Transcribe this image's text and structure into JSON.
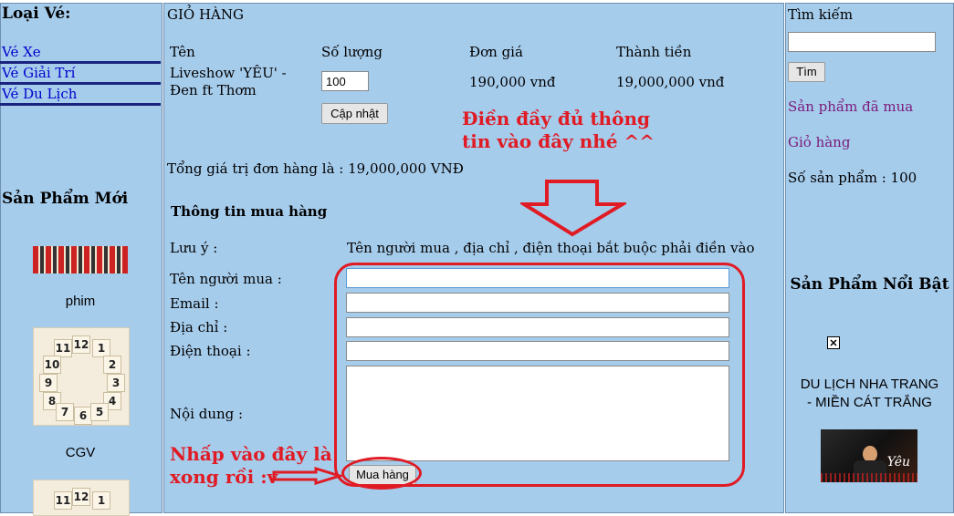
{
  "left": {
    "heading": "Loại Vé:",
    "categories": [
      "Vé Xe",
      "Vé Giải Trí",
      "Vé Du Lịch"
    ],
    "new_products_title": "Sản Phẩm Mới",
    "products": [
      {
        "caption": "phim"
      },
      {
        "caption": "CGV"
      }
    ]
  },
  "cart": {
    "title": "GIỎ HÀNG",
    "headers": {
      "name": "Tên",
      "qty": "Số lượng",
      "price": "Đơn giá",
      "total": "Thành tiền"
    },
    "item": {
      "name": "Liveshow 'YÊU' - Đen ft Thơm",
      "qty": "100",
      "price": "190,000 vnđ",
      "total": "19,000,000 vnđ"
    },
    "update_label": "Cập nhật",
    "order_total": "Tổng giá trị đơn hàng là : 19,000,000 VNĐ"
  },
  "form": {
    "title": "Thông tin mua hàng",
    "note_label": "Lưu ý :",
    "note_text": "Tên người mua , địa chỉ , điện thoại bắt buộc phải điền vào",
    "fields": {
      "buyer": "Tên người mua :",
      "email": "Email :",
      "address": "Địa chỉ :",
      "phone": "Điện thoại :",
      "content": "Nội dung :"
    },
    "buy_label": "Mua hàng"
  },
  "annotations": {
    "fill_line1": "Điền đầy đủ thông",
    "fill_line2": "tin vào đây nhé ^^",
    "click_line1": "Nhấp vào đây là",
    "click_line2": "xong rồi :v"
  },
  "right": {
    "search_label": "Tìm kiếm",
    "search_button": "Tìm",
    "purchased_link": "Sản phẩm đã mua",
    "cart_link": "Giỏ hàng",
    "product_count": "Số sản phẩm : 100",
    "featured_title": "Sản Phẩm Nổi Bật",
    "featured_item_line1": "DU LỊCH NHA TRANG",
    "featured_item_line2": "- MIỀN CÁT TRẮNG",
    "thumb_text": "Yêu"
  },
  "colors": {
    "panel": "#a6ccec",
    "link": "#0000cc",
    "visited": "#7a1a7a",
    "annotation": "#e01b24"
  }
}
